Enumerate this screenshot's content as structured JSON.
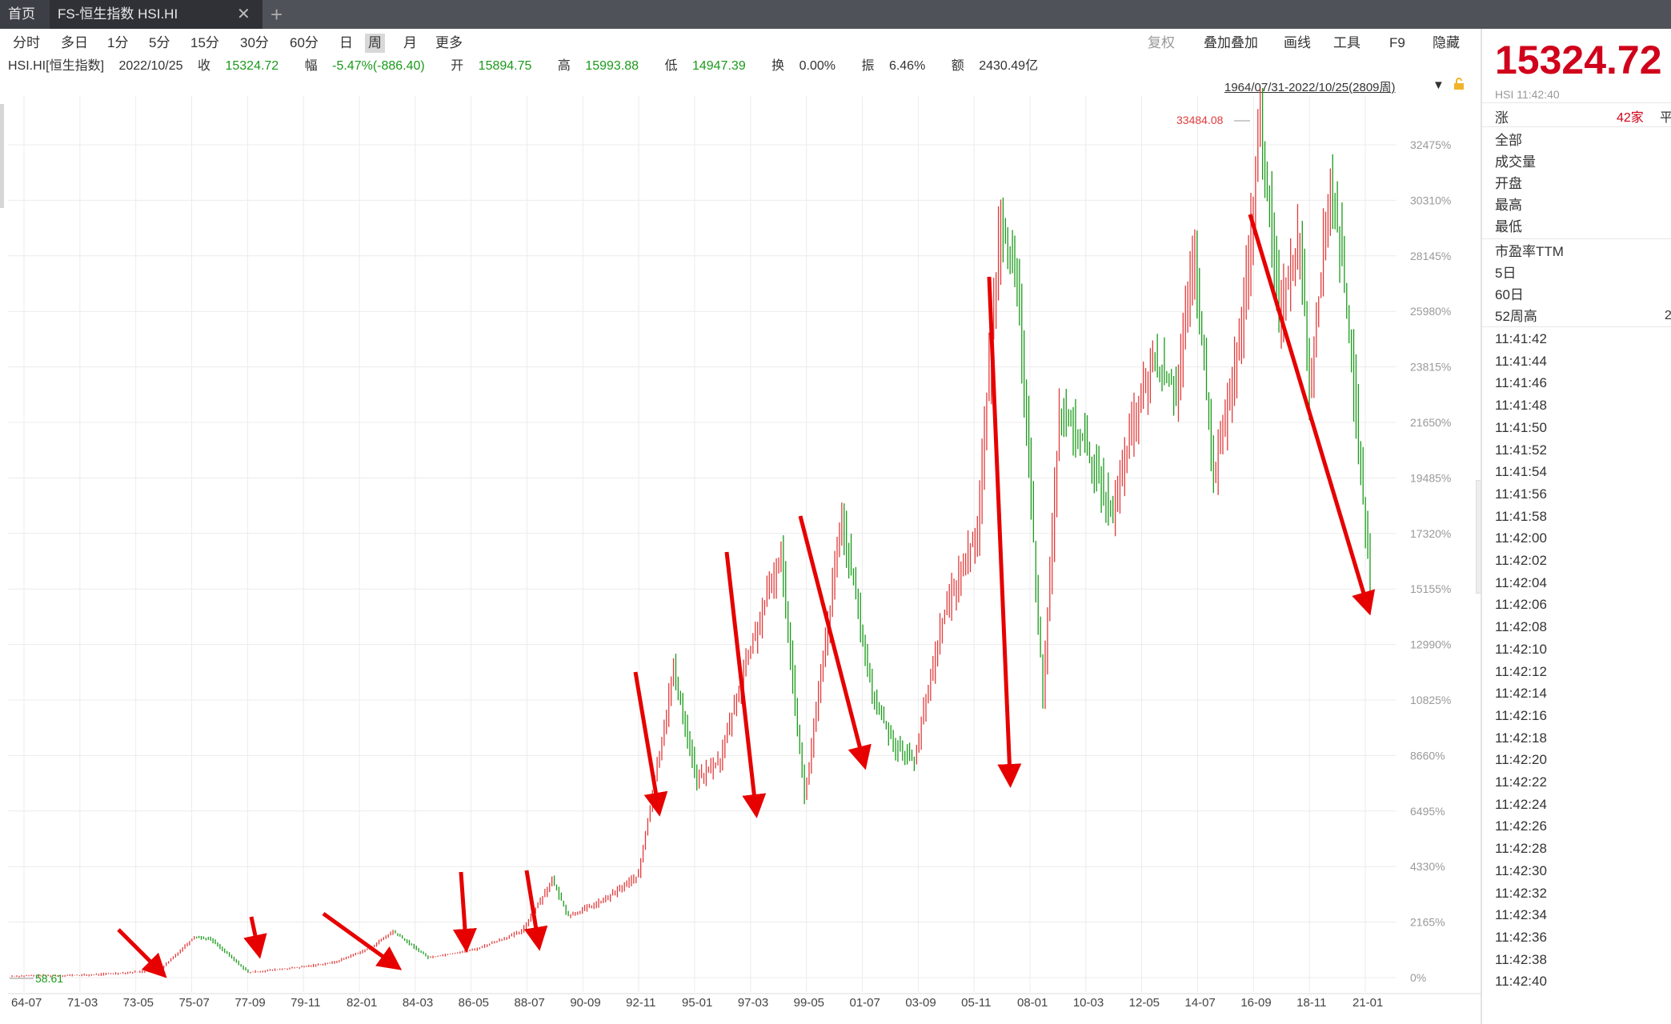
{
  "tabs": {
    "home": "首页",
    "active": "FS-恒生指数 HSI.HI",
    "close": "✕",
    "add": "+"
  },
  "toolbar": {
    "periods": [
      "分时",
      "多日",
      "1分",
      "5分",
      "15分",
      "30分",
      "60分",
      "日",
      "周",
      "月",
      "更多"
    ],
    "active_period": "周",
    "right_tools": [
      "复权",
      "叠加叠加",
      "画线",
      "工具",
      "F9",
      "隐藏"
    ]
  },
  "info": {
    "symbol": "HSI.HI[恒生指数]",
    "date": "2022/10/25",
    "close_label": "收",
    "close": "15324.72",
    "change_label": "幅",
    "change": "-5.47%(-886.40)",
    "open_label": "开",
    "open": "15894.75",
    "high_label": "高",
    "high": "15993.88",
    "low_label": "低",
    "low": "14947.39",
    "turnover_label": "换",
    "turnover": "0.00%",
    "amplitude_label": "振",
    "amplitude": "6.46%",
    "amount_label": "额",
    "amount": "2430.49亿"
  },
  "range": "1964/07/31-2022/10/25(2809周)",
  "chart_data": {
    "type": "line",
    "x_ticks": [
      "64-07",
      "71-03",
      "73-05",
      "75-07",
      "77-09",
      "79-11",
      "82-01",
      "84-03",
      "86-05",
      "88-07",
      "90-09",
      "92-11",
      "95-01",
      "97-03",
      "99-05",
      "01-07",
      "03-09",
      "05-11",
      "08-01",
      "10-03",
      "12-05",
      "14-07",
      "16-09",
      "18-11",
      "21-01"
    ],
    "y_ticks": [
      "0%",
      "2165%",
      "4330%",
      "6495%",
      "8660%",
      "10825%",
      "12990%",
      "15155%",
      "17320%",
      "19485%",
      "21650%",
      "23815%",
      "25980%",
      "28145%",
      "30310%",
      "32475%"
    ],
    "high_annotation": "33484.08",
    "low_annotation": "58.61",
    "series": [
      {
        "x": [
          1964.6,
          1968,
          1971,
          1972.5,
          1973.2,
          1974.8,
          1977,
          1978.5,
          1980,
          1981,
          1982.5,
          1984.5,
          1986.5,
          1987.8,
          1988.5,
          1990,
          1991.5,
          1993,
          1994,
          1995,
          1996,
          1997.6,
          1998.6,
          1999.5,
          2000.2,
          2001.5,
          2002.5,
          2003.3,
          2004.5,
          2006,
          2007,
          2007.8,
          2008.8,
          2009.5,
          2010.5,
          2011.8,
          2012.5,
          2013.5,
          2014.5,
          2015.3,
          2016.1,
          2017.3,
          2018.1,
          2018.9,
          2019.8,
          2020.2,
          2021.1,
          2021.6,
          2022.2,
          2022.8
        ],
        "y": [
          58.6,
          100,
          280,
          1600,
          1500,
          200,
          400,
          600,
          1150,
          1800,
          780,
          1100,
          1800,
          3800,
          2400,
          3000,
          4000,
          12000,
          7700,
          8500,
          12000,
          16500,
          7000,
          13000,
          18000,
          11000,
          9000,
          8500,
          14000,
          17500,
          30000,
          26000,
          11000,
          22000,
          21000,
          18000,
          21000,
          24000,
          23000,
          28000,
          19500,
          25000,
          33484,
          26000,
          29000,
          23000,
          31000,
          28000,
          22000,
          15324.72
        ]
      }
    ],
    "annotations": "red arrows mark major drawdowns"
  },
  "sidebar": {
    "price": "15324.72",
    "subline": "HSI 11:42:40",
    "row_labels": [
      "涨",
      "全部",
      "成交量",
      "开盘",
      "最高",
      "最低",
      "市盈率TTM",
      "5日",
      "60日",
      "52周高"
    ],
    "count": "42家",
    "peek": "平",
    "peek2": "2",
    "times": [
      "11:41:42",
      "11:41:44",
      "11:41:46",
      "11:41:48",
      "11:41:50",
      "11:41:52",
      "11:41:54",
      "11:41:56",
      "11:41:58",
      "11:42:00",
      "11:42:02",
      "11:42:04",
      "11:42:06",
      "11:42:08",
      "11:42:10",
      "11:42:12",
      "11:42:14",
      "11:42:16",
      "11:42:18",
      "11:42:20",
      "11:42:22",
      "11:42:24",
      "11:42:26",
      "11:42:28",
      "11:42:30",
      "11:42:32",
      "11:42:34",
      "11:42:36",
      "11:42:38",
      "11:42:40"
    ]
  },
  "colors": {
    "up": "#e23b3b",
    "down": "#1a9a1a",
    "arrow": "#e60000",
    "grid": "#ececec"
  }
}
